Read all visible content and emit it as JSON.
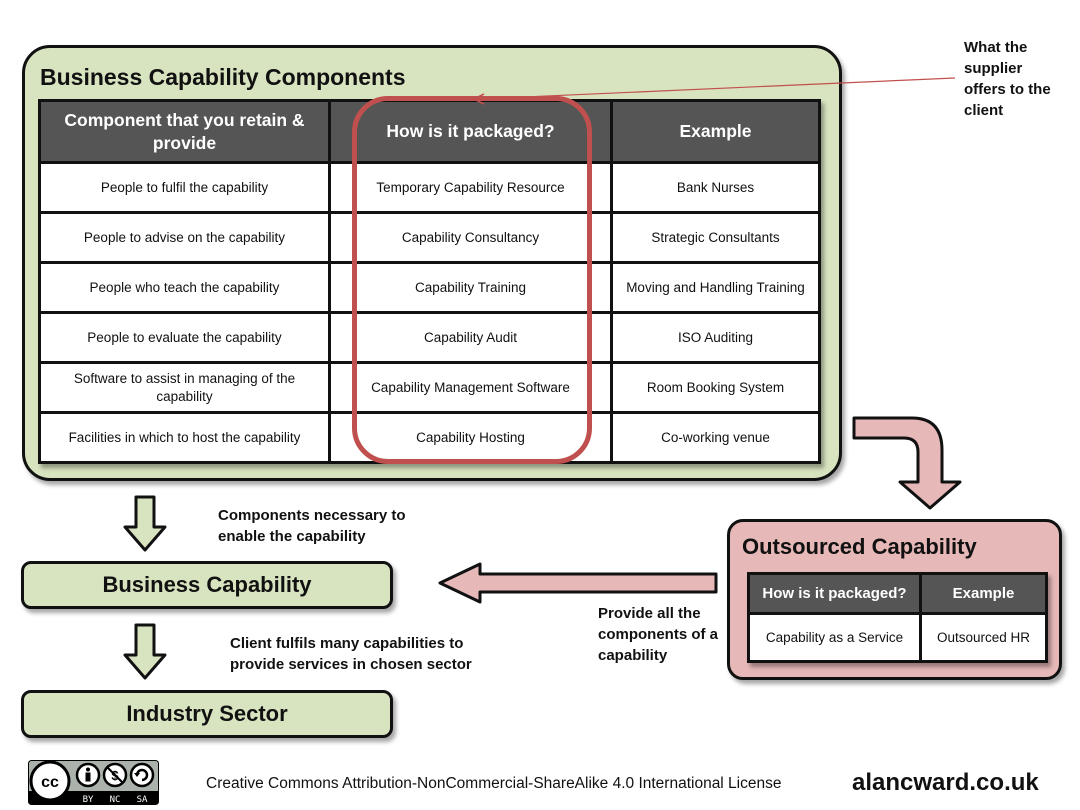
{
  "main_panel": {
    "title": "Business Capability Components",
    "columns": [
      "Component that you retain & provide",
      "How is it packaged?",
      "Example"
    ],
    "rows": [
      [
        "People to fulfil the capability",
        "Temporary Capability Resource",
        "Bank Nurses"
      ],
      [
        "People to advise on the capability",
        "Capability Consultancy",
        "Strategic Consultants"
      ],
      [
        "People who teach the capability",
        "Capability Training",
        "Moving and Handling Training"
      ],
      [
        "People to evaluate the capability",
        "Capability Audit",
        "ISO Auditing"
      ],
      [
        "Software to assist in managing of the capability",
        "Capability Management Software",
        "Room Booking System"
      ],
      [
        "Facilities in which to host the capability",
        "Capability Hosting",
        "Co-working venue"
      ]
    ],
    "highlighted_column": "How is it packaged?"
  },
  "annotation": {
    "text": "What the supplier offers to the client"
  },
  "outsourced_panel": {
    "title": "Outsourced Capability",
    "columns": [
      "How is it packaged?",
      "Example"
    ],
    "rows": [
      [
        "Capability as a Service",
        "Outsourced HR"
      ]
    ]
  },
  "flow": {
    "business_capability": "Business Capability",
    "industry_sector": "Industry Sector",
    "label_components": "Components necessary to enable the capability",
    "label_client": "Client fulfils many capabilities to provide services in chosen sector",
    "label_provide": "Provide all the components of a capability"
  },
  "footer": {
    "cc_badge_labels": [
      "BY",
      "NC",
      "SA"
    ],
    "license": "Creative Commons Attribution-NonCommercial-ShareAlike 4.0 International License",
    "site": "alancward.co.uk"
  },
  "colors": {
    "green_fill": "#d8e4c0",
    "pink_fill": "#e6b9b8",
    "header_fill": "#555555",
    "highlight": "#c0504d"
  }
}
